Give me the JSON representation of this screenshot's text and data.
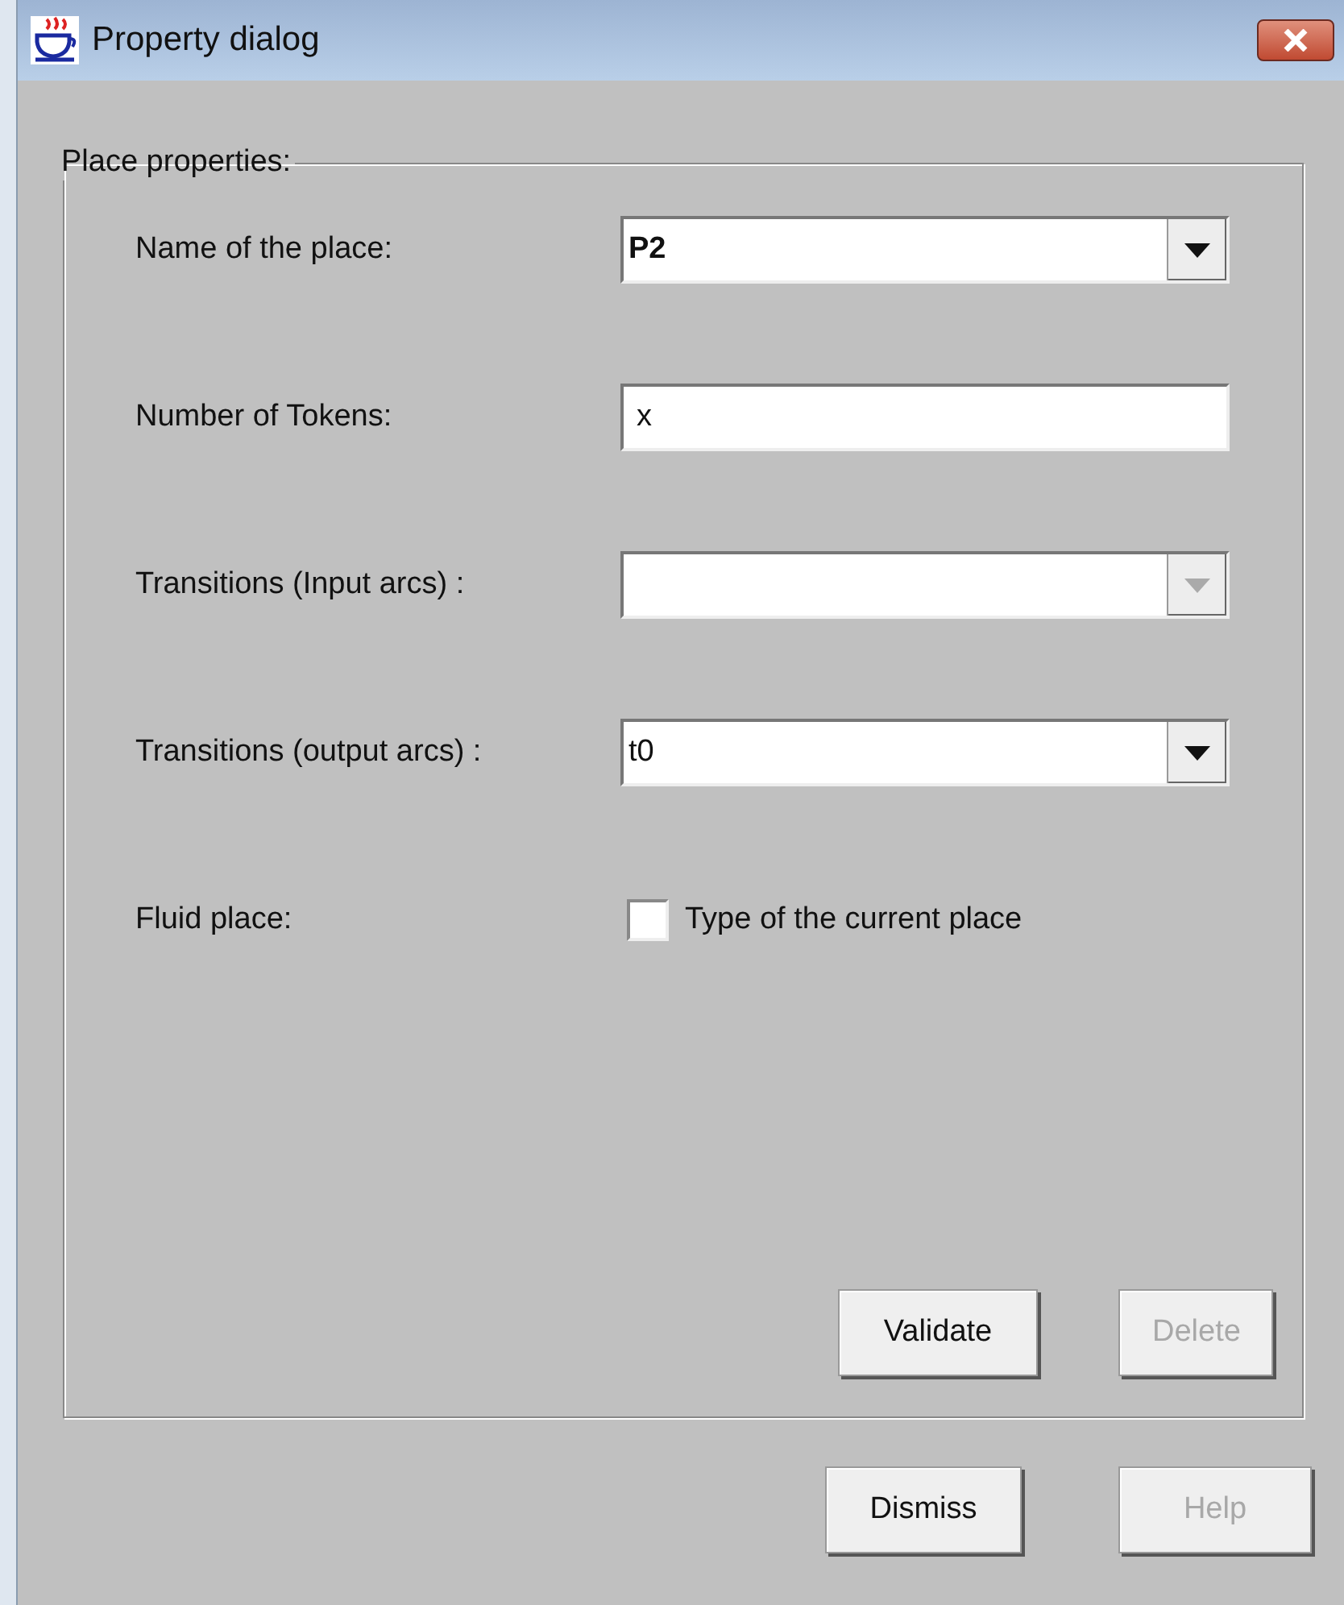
{
  "window": {
    "title": "Property dialog"
  },
  "group": {
    "title": "Place properties:"
  },
  "fields": [
    {
      "kind": "combo",
      "label": "Name of the place:",
      "value": "P2",
      "bold": true,
      "disabled": false
    },
    {
      "kind": "text",
      "label": "Number of Tokens:",
      "value": "x"
    },
    {
      "kind": "combo",
      "label": "Transitions (Input arcs) :",
      "disabled": true
    },
    {
      "kind": "combo",
      "label": "Transitions (output arcs) :",
      "value": "t0",
      "bold": false,
      "disabled": false
    },
    {
      "kind": "checkbox",
      "label": "Fluid place:",
      "text": "Type of the current place",
      "checked": false
    }
  ],
  "group_buttons": [
    {
      "label": "Validate",
      "disabled": false
    },
    {
      "label": "Delete",
      "disabled": true
    }
  ],
  "buttons": [
    {
      "label": "Dismiss",
      "disabled": false
    },
    {
      "label": "Help",
      "disabled": true
    }
  ]
}
